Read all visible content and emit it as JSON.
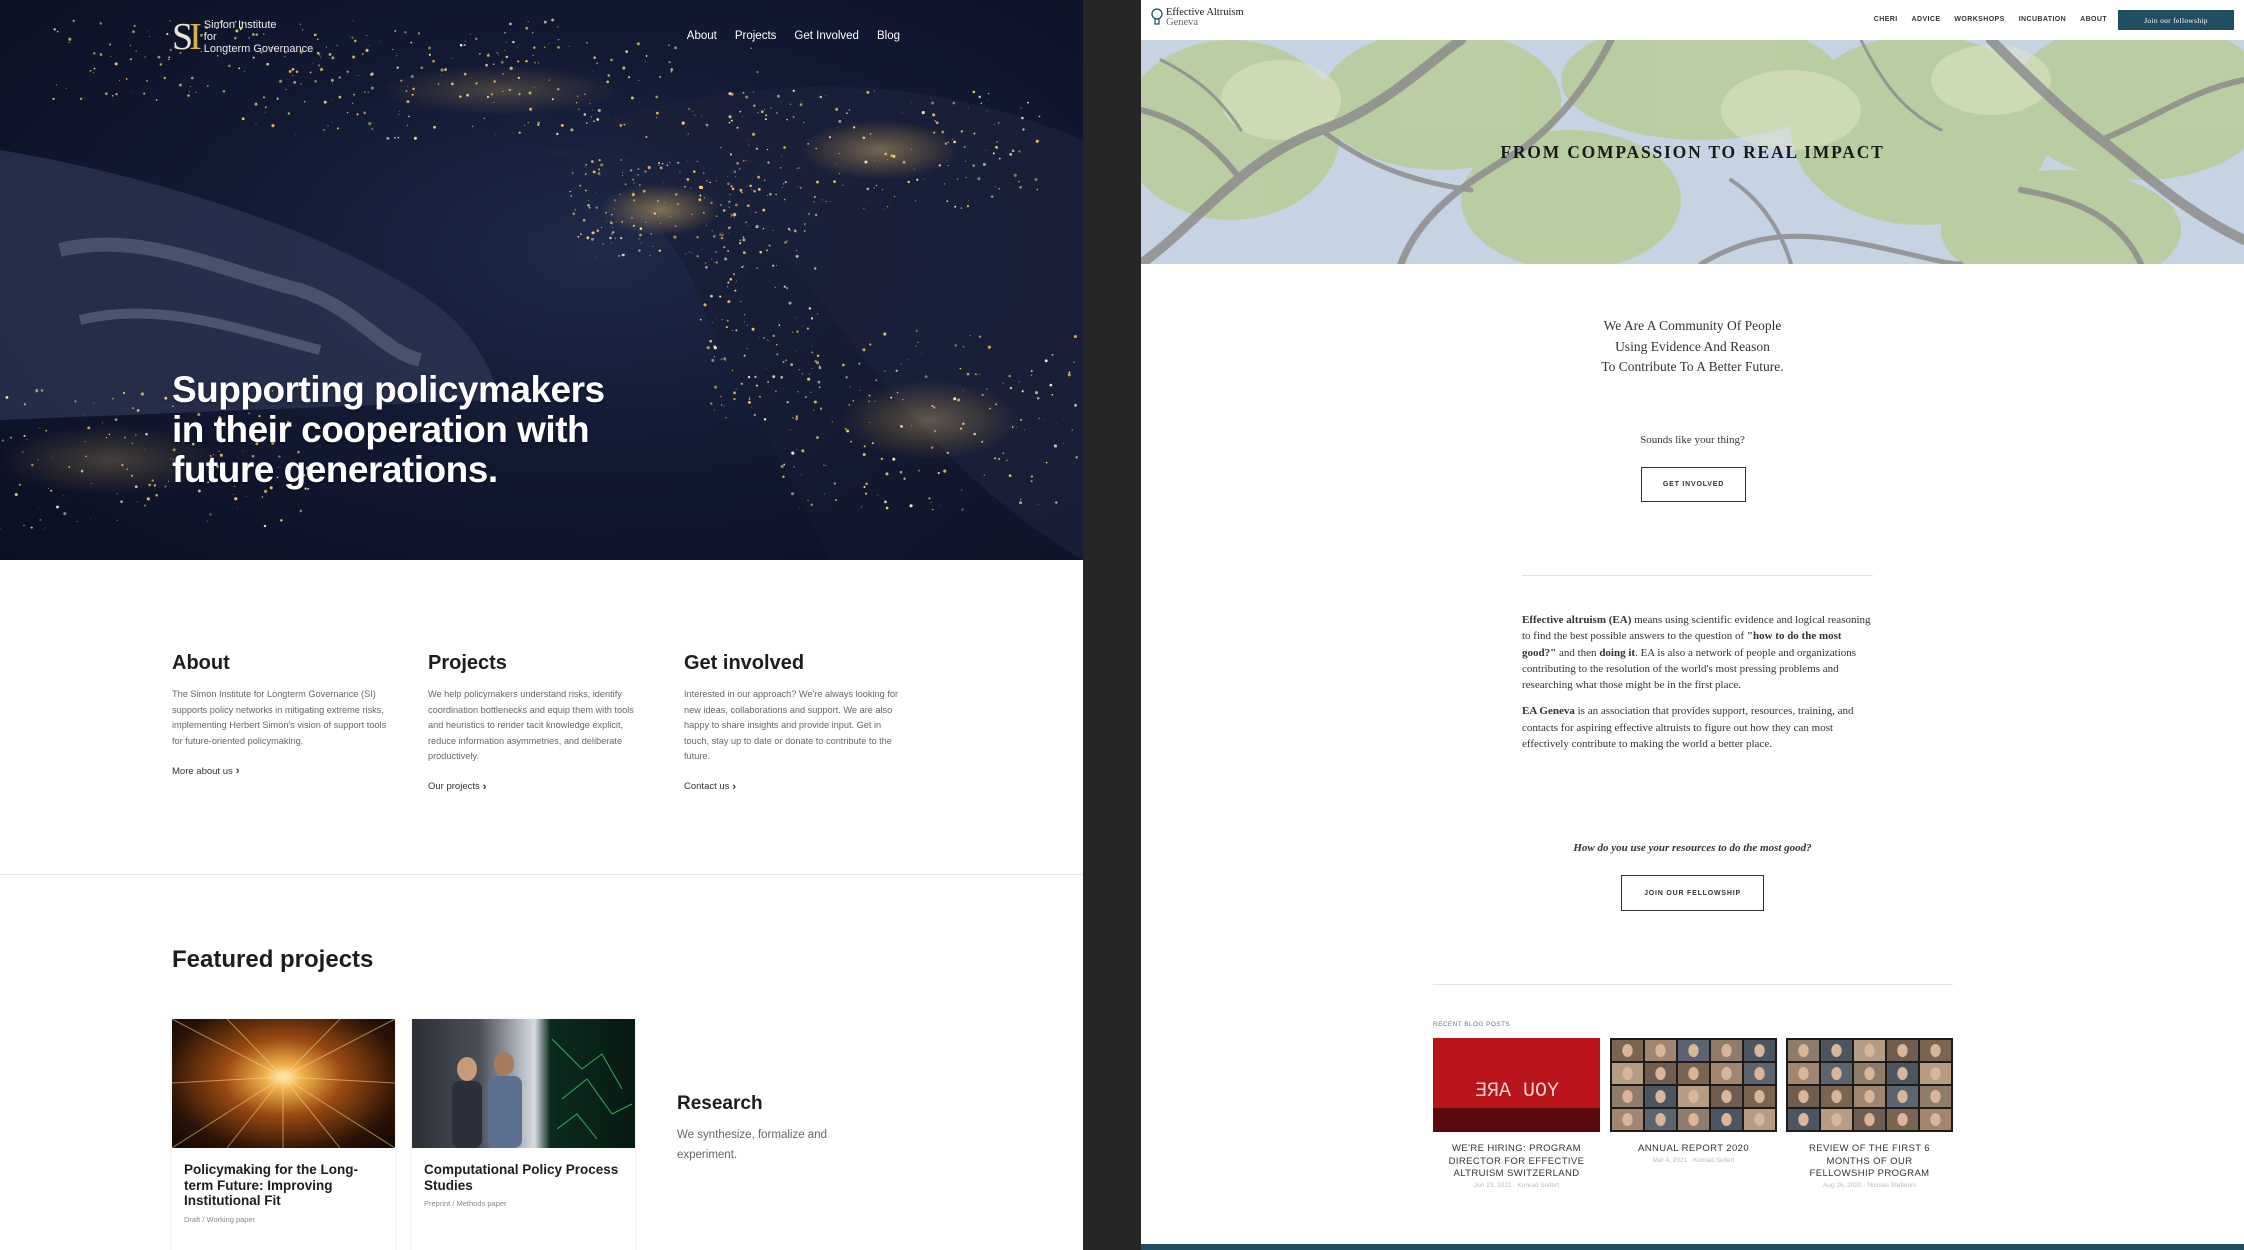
{
  "left_site": {
    "logo": {
      "mark": "SI",
      "line1": "Simon Institute",
      "line2": "for",
      "line3": "Longterm Governance"
    },
    "nav": [
      "About",
      "Projects",
      "Get Involved",
      "Blog"
    ],
    "hero_headline": "Supporting policymakers\nin their cooperation with\nfuture generations.",
    "columns": [
      {
        "title": "About",
        "text": "The Simon Institute for Longterm Governance (SI) supports policy networks in mitigating extreme risks, implementing Herbert Simon's vision of support tools for future-oriented policymaking.",
        "link": "More about us"
      },
      {
        "title": "Projects",
        "text": "We help policymakers understand risks, identify coordination bottlenecks and equip them with tools and heuristics to render tacit knowledge explicit, reduce information asymmetries, and deliberate productively.",
        "link": "Our projects"
      },
      {
        "title": "Get involved",
        "text": "Interested in our approach? We're always looking for new ideas, collaborations and support. We are also happy to share insights and provide input. Get in touch, stay up to date or donate to contribute to the future.",
        "link": "Contact us"
      }
    ],
    "featured_title": "Featured projects",
    "cards": [
      {
        "title": "Policymaking for the Long-term Future: Improving Institutional Fit",
        "tag": "Draft / Working paper"
      },
      {
        "title": "Computational Policy Process Studies",
        "tag": "Preprint / Methods paper"
      }
    ],
    "research": {
      "title": "Research",
      "text": "We synthesize, formalize and experiment."
    }
  },
  "right_site": {
    "logo": {
      "line1": "Effective Altruism",
      "line2": "Geneva"
    },
    "nav": [
      "CHERI",
      "ADVICE",
      "WORKSHOPS",
      "INCUBATION",
      "ABOUT"
    ],
    "cta": "Join our fellowship",
    "hero_title": "FROM COMPASSION TO REAL IMPACT",
    "tagline": "We Are A Community Of People\nUsing Evidence And Reason\nTo Contribute To A Better Future.",
    "sounds": "Sounds like your thing?",
    "get_involved": "GET INVOLVED",
    "body": {
      "p1_bold1": "Effective altruism (EA)",
      "p1_a": " means using scientific evidence and logical reasoning to find the best possible answers to the question of ",
      "p1_bold2": "\"how to do the most good?\"",
      "p1_b": " and then ",
      "p1_bold3": "doing it",
      "p1_c": ". EA is also a network of people and organizations contributing to the resolution of the world's most pressing problems and researching what those might be in the first place.",
      "p2_bold": "EA Geneva",
      "p2": " is an association that provides support, resources, training, and contacts for aspiring effective altruists to figure out how they can most effectively contribute to making the world a better place."
    },
    "question": "How do you use your resources to do the most good?",
    "join_fellowship": "JOIN OUR FELLOWSHIP",
    "recent_label": "RECENT BLOG POSTS",
    "posts": [
      {
        "title": "WE'RE HIRING: PROGRAM DIRECTOR FOR EFFECTIVE ALTRUISM SWITZERLAND",
        "meta": "Jun 23, 2021 · Konrad Seifert",
        "sign": "YOU ARE"
      },
      {
        "title": "ANNUAL REPORT 2020",
        "meta": "Mar 4, 2021 · Konrad Seifert"
      },
      {
        "title": "REVIEW OF THE FIRST 6 MONTHS OF OUR FELLOWSHIP PROGRAM",
        "meta": "Aug 26, 2020 · Nicolas Stefanini"
      }
    ],
    "brand_color": "#1f4e63"
  }
}
